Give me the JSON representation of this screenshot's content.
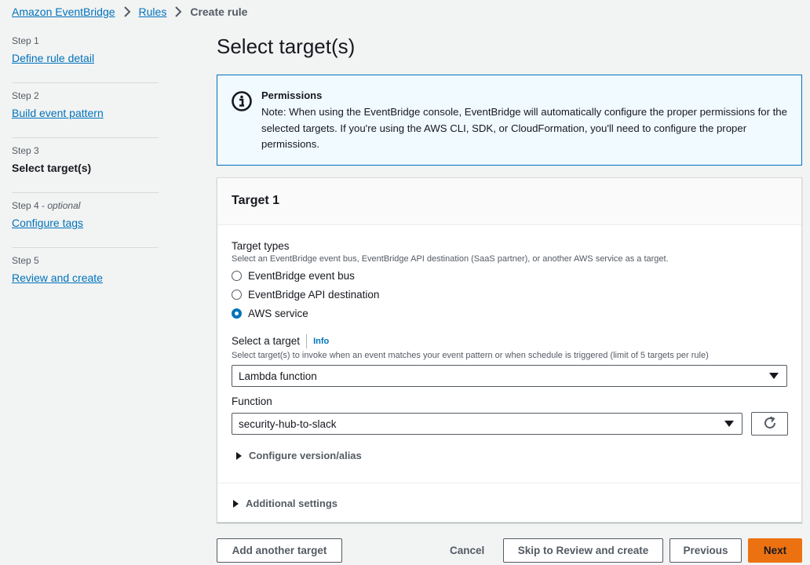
{
  "breadcrumb": {
    "items": [
      "Amazon EventBridge",
      "Rules"
    ],
    "current": "Create rule"
  },
  "steps": [
    {
      "number": "Step 1",
      "optional": "",
      "label": "Define rule detail"
    },
    {
      "number": "Step 2",
      "optional": "",
      "label": "Build event pattern"
    },
    {
      "number": "Step 3",
      "optional": "",
      "label": "Select target(s)"
    },
    {
      "number": "Step 4",
      "optional": "optional",
      "label": "Configure tags"
    },
    {
      "number": "Step 5",
      "optional": "",
      "label": "Review and create"
    }
  ],
  "page_title": "Select target(s)",
  "alert": {
    "icon": "info-circle-icon",
    "title": "Permissions",
    "body": "Note: When using the EventBridge console, EventBridge will automatically configure the proper permissions for the selected targets. If you're using the AWS CLI, SDK, or CloudFormation, you'll need to configure the proper permissions."
  },
  "target": {
    "title": "Target 1",
    "types_label": "Target types",
    "types_desc": "Select an EventBridge event bus, EventBridge API destination (SaaS partner), or another AWS service as a target.",
    "types": [
      {
        "label": "EventBridge event bus",
        "selected": false
      },
      {
        "label": "EventBridge API destination",
        "selected": false
      },
      {
        "label": "AWS service",
        "selected": true
      }
    ],
    "select_label": "Select a target",
    "info_link": "Info",
    "select_desc": "Select target(s) to invoke when an event matches your event pattern or when schedule is triggered (limit of 5 targets per rule)",
    "select_value": "Lambda function",
    "function_label": "Function",
    "function_value": "security-hub-to-slack",
    "refresh_icon": "refresh-icon",
    "configure_version": "Configure version/alias",
    "additional_settings": "Additional settings"
  },
  "footer": {
    "add_target": "Add another target",
    "cancel": "Cancel",
    "skip": "Skip to Review and create",
    "previous": "Previous",
    "next": "Next"
  },
  "colors": {
    "link": "#0073bb",
    "primary": "#ec7211",
    "alert_bg": "#f1faff"
  }
}
